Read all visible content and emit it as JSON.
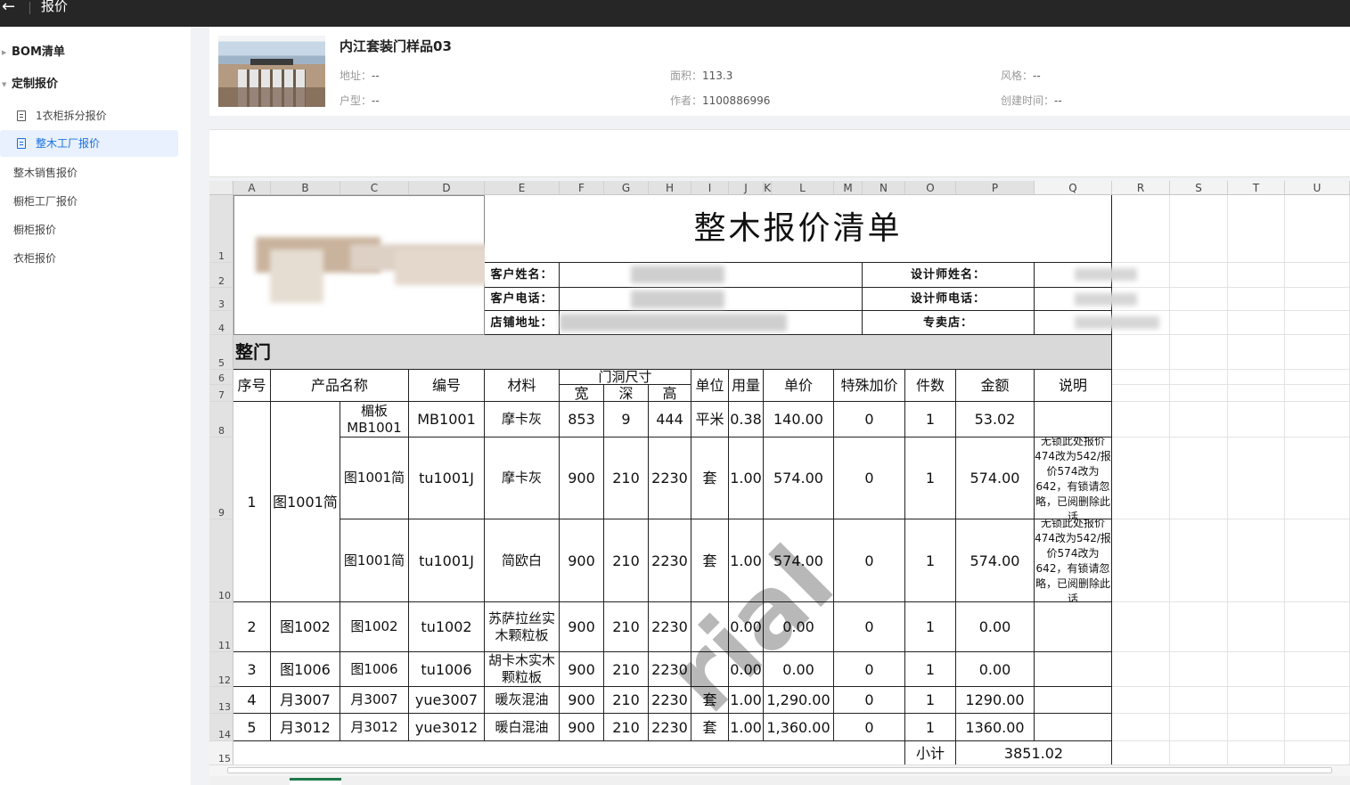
{
  "topbar": {
    "back_icon": "arrow-left-icon",
    "title": "报价"
  },
  "sidebar": {
    "groups": [
      {
        "label": "BOM清单"
      },
      {
        "label": "定制报价"
      }
    ],
    "items": [
      {
        "label": "1衣柜拆分报价"
      },
      {
        "label": "整木工厂报价"
      },
      {
        "label": "整木销售报价"
      },
      {
        "label": "橱柜工厂报价"
      },
      {
        "label": "橱柜报价"
      },
      {
        "label": "衣柜报价"
      }
    ]
  },
  "project": {
    "title": "内江套装门样品03",
    "address_label": "地址：",
    "address": "--",
    "layout_label": "户型：",
    "layout": "--",
    "area_label": "面积：",
    "area": "113.3",
    "author_label": "作者：",
    "author": "1100886996",
    "style_label": "风格：",
    "style": "--",
    "created_label": "创建时间：",
    "created": "--"
  },
  "sheet": {
    "columns": [
      "A",
      "B",
      "C",
      "D",
      "E",
      "F",
      "G",
      "H",
      "I",
      "J",
      "K",
      "L",
      "M",
      "N",
      "O",
      "P",
      "Q",
      "R",
      "S",
      "T",
      "U"
    ],
    "rows": [
      "1",
      "2",
      "3",
      "4",
      "5",
      "6",
      "7",
      "8",
      "9",
      "10",
      "11",
      "12",
      "13",
      "14",
      "15"
    ],
    "title": "整木报价清单",
    "customer_name_label": "客户姓名：",
    "customer_phone_label": "客户电话：",
    "store_address_label": "店铺地址：",
    "designer_name_label": "设计师姓名：",
    "designer_phone_label": "设计师电话：",
    "shop_label": "专卖店：",
    "section": "整门",
    "headers": {
      "seq": "序号",
      "product": "产品名称",
      "code": "编号",
      "material": "材料",
      "opening": "门洞尺寸",
      "width": "宽",
      "depth": "深",
      "height": "高",
      "unit": "单位",
      "qty": "用量",
      "price": "单价",
      "surcharge": "特殊加价",
      "pieces": "件数",
      "amount": "金额",
      "note": "说明"
    },
    "groups": [
      {
        "seq": "1",
        "product": "图1001简"
      },
      {
        "seq": "2",
        "product": "图1002"
      },
      {
        "seq": "3",
        "product": "图1006"
      },
      {
        "seq": "4",
        "product": "月3007"
      },
      {
        "seq": "5",
        "product": "月3012"
      }
    ],
    "lines": [
      {
        "name": "楣板MB1001",
        "code": "MB1001",
        "material": "摩卡灰",
        "w": "853",
        "d": "9",
        "h": "444",
        "unit": "平米",
        "qty": "0.38",
        "price": "140.00",
        "surcharge": "0",
        "pieces": "1",
        "amount": "53.02",
        "note": ""
      },
      {
        "name": "图1001简",
        "code": "tu1001J",
        "material": "摩卡灰",
        "w": "900",
        "d": "210",
        "h": "2230",
        "unit": "套",
        "qty": "1.00",
        "price": "574.00",
        "surcharge": "0",
        "pieces": "1",
        "amount": "574.00",
        "note": "无锁此处报价474改为542/报价574改为642，有锁请忽略，已阅删除此话"
      },
      {
        "name": "图1001简",
        "code": "tu1001J",
        "material": "简欧白",
        "w": "900",
        "d": "210",
        "h": "2230",
        "unit": "套",
        "qty": "1.00",
        "price": "574.00",
        "surcharge": "0",
        "pieces": "1",
        "amount": "574.00",
        "note": "无锁此处报价474改为542/报价574改为642，有锁请忽略，已阅删除此话"
      },
      {
        "name": "图1002",
        "code": "tu1002",
        "material": "苏萨拉丝实木颗粒板",
        "w": "900",
        "d": "210",
        "h": "2230",
        "unit": "",
        "qty": "0.00",
        "price": "0.00",
        "surcharge": "0",
        "pieces": "1",
        "amount": "0.00",
        "note": ""
      },
      {
        "name": "图1006",
        "code": "tu1006",
        "material": "胡卡木实木颗粒板",
        "w": "900",
        "d": "210",
        "h": "2230",
        "unit": "",
        "qty": "0.00",
        "price": "0.00",
        "surcharge": "0",
        "pieces": "1",
        "amount": "0.00",
        "note": ""
      },
      {
        "name": "月3007",
        "code": "yue3007",
        "material": "暖灰混油",
        "w": "900",
        "d": "210",
        "h": "2230",
        "unit": "套",
        "qty": "1.00",
        "price": "1,290.00",
        "surcharge": "0",
        "pieces": "1",
        "amount": "1290.00",
        "note": ""
      },
      {
        "name": "月3012",
        "code": "yue3012",
        "material": "暖白混油",
        "w": "900",
        "d": "210",
        "h": "2230",
        "unit": "套",
        "qty": "1.00",
        "price": "1,360.00",
        "surcharge": "0",
        "pieces": "1",
        "amount": "1360.00",
        "note": ""
      }
    ],
    "subtotal_label": "小计",
    "subtotal": "3851.02",
    "watermark": "rial"
  }
}
